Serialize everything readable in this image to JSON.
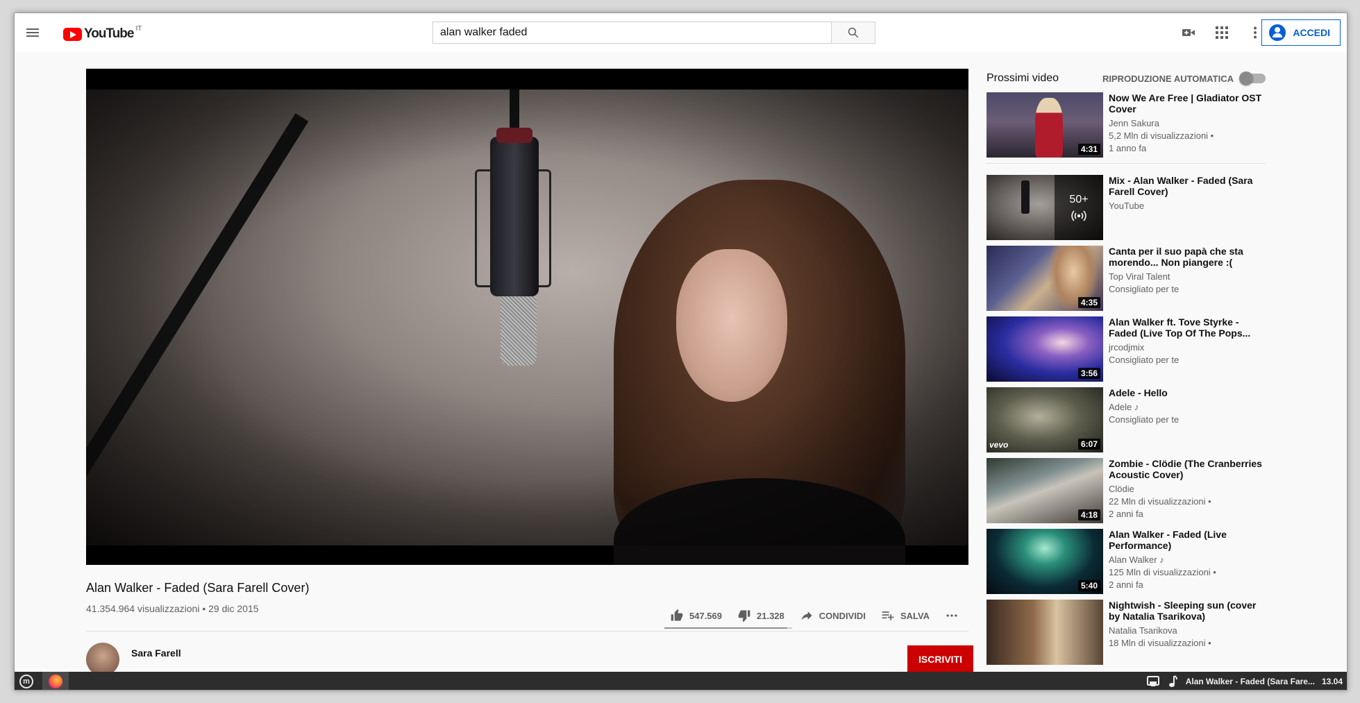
{
  "masthead": {
    "logo_text": "YouTube",
    "logo_country": "IT",
    "search_value": "alan walker faded",
    "signin_label": "ACCEDI"
  },
  "video": {
    "title": "Alan Walker - Faded (Sara Farell Cover)",
    "meta": "41.354.964 visualizzazioni • 29 dic 2015",
    "likes": "547.569",
    "dislikes": "21.328",
    "like_ratio": 0.962,
    "share_label": "CONDIVIDI",
    "save_label": "SALVA",
    "channel_name": "Sara Farell",
    "subscribe_label": "ISCRIVITI"
  },
  "up_next": {
    "title": "Prossimi video",
    "autoplay_label": "RIPRODUZIONE AUTOMATICA",
    "items": [
      {
        "title": "Now We Are Free | Gladiator OST Cover",
        "channel": "Jenn Sakura",
        "line2": "5,2 Mln di visualizzazioni •",
        "line3": "1 anno fa",
        "duration": "4:31"
      },
      {
        "title": "Mix - Alan Walker - Faded (Sara Farell Cover)",
        "channel": "YouTube",
        "line2": "",
        "line3": "",
        "duration": "",
        "mix_count": "50+"
      },
      {
        "title": "Canta per il suo papà che sta morendo... Non piangere :(",
        "channel": "Top Viral Talent",
        "line2": "Consigliato per te",
        "line3": "",
        "duration": "4:35"
      },
      {
        "title": "Alan Walker ft. Tove Styrke - Faded (Live Top Of The Pops...",
        "channel": "jrcodjmix",
        "line2": "Consigliato per te",
        "line3": "",
        "duration": "3:56"
      },
      {
        "title": "Adele - Hello",
        "channel": "Adele ♪",
        "line2": "Consigliato per te",
        "line3": "",
        "duration": "6:07",
        "badge": "vevo"
      },
      {
        "title": "Zombie - Clödie (The Cranberries Acoustic Cover)",
        "channel": "Clödie",
        "line2": "22 Mln di visualizzazioni •",
        "line3": "2 anni fa",
        "duration": "4:18"
      },
      {
        "title": "Alan Walker - Faded (Live Performance)",
        "channel": "Alan Walker ♪",
        "line2": "125 Mln di visualizzazioni •",
        "line3": "2 anni fa",
        "duration": "5:40"
      },
      {
        "title": "Nightwish - Sleeping sun (cover by Natalia Tsarikova)",
        "channel": "Natalia Tsarikova",
        "line2": "18 Mln di visualizzazioni •",
        "line3": "",
        "duration": ""
      }
    ]
  },
  "taskbar": {
    "start_label": "m",
    "now_playing": "Alan Walker - Faded (Sara Fare...",
    "clock": "13.04"
  },
  "colors": {
    "brand_red": "#ff0000",
    "accent_blue": "#065fd4",
    "subscribe_red": "#cc0000",
    "taskbar": "#2d2d2d"
  }
}
